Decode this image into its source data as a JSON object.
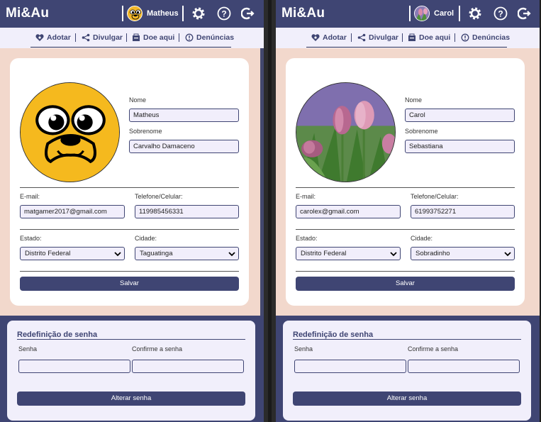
{
  "app": {
    "brand": "Mi&Au",
    "nav": [
      "Adotar",
      "Divulgar",
      "Doe aqui",
      "Denúncias"
    ],
    "icons": [
      "settings-icon",
      "help-icon",
      "logout-icon"
    ]
  },
  "labels": {
    "first_name": "Nome",
    "last_name": "Sobrenome",
    "email": "E-mail:",
    "phone": "Telefone/Celular:",
    "state": "Estado:",
    "city": "Cidade:",
    "save": "Salvar",
    "pw_title": "Redefinição de senha",
    "pw": "Senha",
    "pw_confirm": "Confirme a senha",
    "pw_button": "Alterar senha"
  },
  "screens": [
    {
      "user": "Matheus",
      "avatar": "jake-dog-avatar",
      "first_name": "Matheus",
      "last_name": "Carvalho Damaceno",
      "email": "matgamer2017@gmail.com",
      "phone": "119985456331",
      "state": "Distrito Federal",
      "city": "Taguatinga"
    },
    {
      "user": "Carol",
      "avatar": "tulips-avatar",
      "first_name": "Carol",
      "last_name": "Sebastiana",
      "email": "carolex@gmail.com",
      "phone": "61993752271",
      "state": "Distrito Federal",
      "city": "Sobradinho"
    }
  ],
  "colors": {
    "primary": "#3f4573",
    "background": "#f2d8cc",
    "input": "#f1eefb"
  }
}
